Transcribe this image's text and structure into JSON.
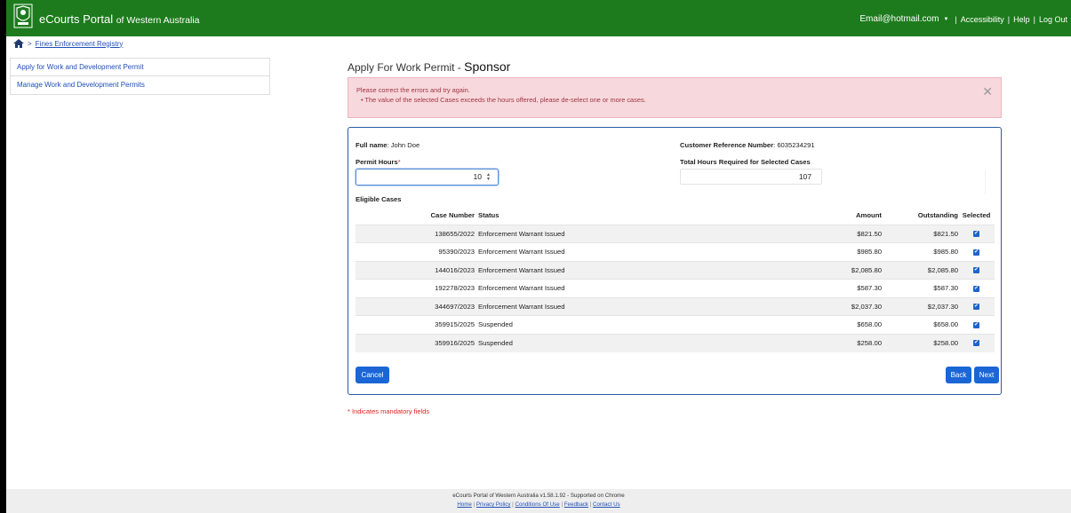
{
  "header": {
    "brand_main": "eCourts Portal",
    "brand_sub": "of Western Australia",
    "email": "Email@hotmail.com",
    "links": [
      "Accessibility",
      "Help",
      "Log Out"
    ],
    "bg_color": "#1d7b1d"
  },
  "breadcrumb": {
    "link": "Fines Enforcement Registry"
  },
  "sidebar": {
    "items": [
      {
        "label": "Apply for Work and Development Permit"
      },
      {
        "label": "Manage Work and Development Permits"
      }
    ]
  },
  "page": {
    "title_prefix": "Apply For Work Permit -",
    "title_main": "Sponsor"
  },
  "alert": {
    "line1": "Please correct the errors and try again.",
    "line2": "The value of the selected Cases exceeds the hours offered, please de-select one or more cases.",
    "close_glyph": "✕"
  },
  "form": {
    "full_name_label": "Full name",
    "full_name": "John Doe",
    "crn_label": "Customer Reference Number",
    "crn": "6035234291",
    "permit_hours_label": "Permit Hours",
    "permit_hours_value": "10",
    "total_hours_label": "Total Hours Required for Selected Cases",
    "total_hours_value": "107",
    "eligible_label": "Eligible Cases"
  },
  "table": {
    "headers": {
      "case": "Case Number",
      "status": "Status",
      "amount": "Amount",
      "outstanding": "Outstanding",
      "selected": "Selected"
    },
    "rows": [
      {
        "case": "138655/2022",
        "status": "Enforcement Warrant Issued",
        "amount": "$821.50",
        "outstanding": "$821.50",
        "selected": "✔"
      },
      {
        "case": "95390/2023",
        "status": "Enforcement Warrant Issued",
        "amount": "$985.80",
        "outstanding": "$985.80",
        "selected": "✔"
      },
      {
        "case": "144016/2023",
        "status": "Enforcement Warrant Issued",
        "amount": "$2,085.80",
        "outstanding": "$2,085.80",
        "selected": "✔"
      },
      {
        "case": "192278/2023",
        "status": "Enforcement Warrant Issued",
        "amount": "$587.30",
        "outstanding": "$587.30",
        "selected": "✔"
      },
      {
        "case": "344697/2023",
        "status": "Enforcement Warrant Issued",
        "amount": "$2,037.30",
        "outstanding": "$2,037.30",
        "selected": "✔"
      },
      {
        "case": "359915/2025",
        "status": "Suspended",
        "amount": "$658.00",
        "outstanding": "$658.00",
        "selected": "✔"
      },
      {
        "case": "359916/2025",
        "status": "Suspended",
        "amount": "$258.00",
        "outstanding": "$258.00",
        "selected": "✔"
      }
    ]
  },
  "buttons": {
    "cancel": "Cancel",
    "back": "Back",
    "next": "Next"
  },
  "mandatory_note": "* Indicates mandatory fields",
  "footer": {
    "version": "eCourts Portal of Western Australia v1.58.1.92 - Supported on Chrome",
    "links": [
      "Home",
      "Privacy Policy",
      "Conditions Of Use",
      "Feedback",
      "Contact Us"
    ]
  },
  "colors": {
    "accent": "#1a66d6",
    "error_bg": "#f7d8dc",
    "error_text": "#a23645"
  }
}
